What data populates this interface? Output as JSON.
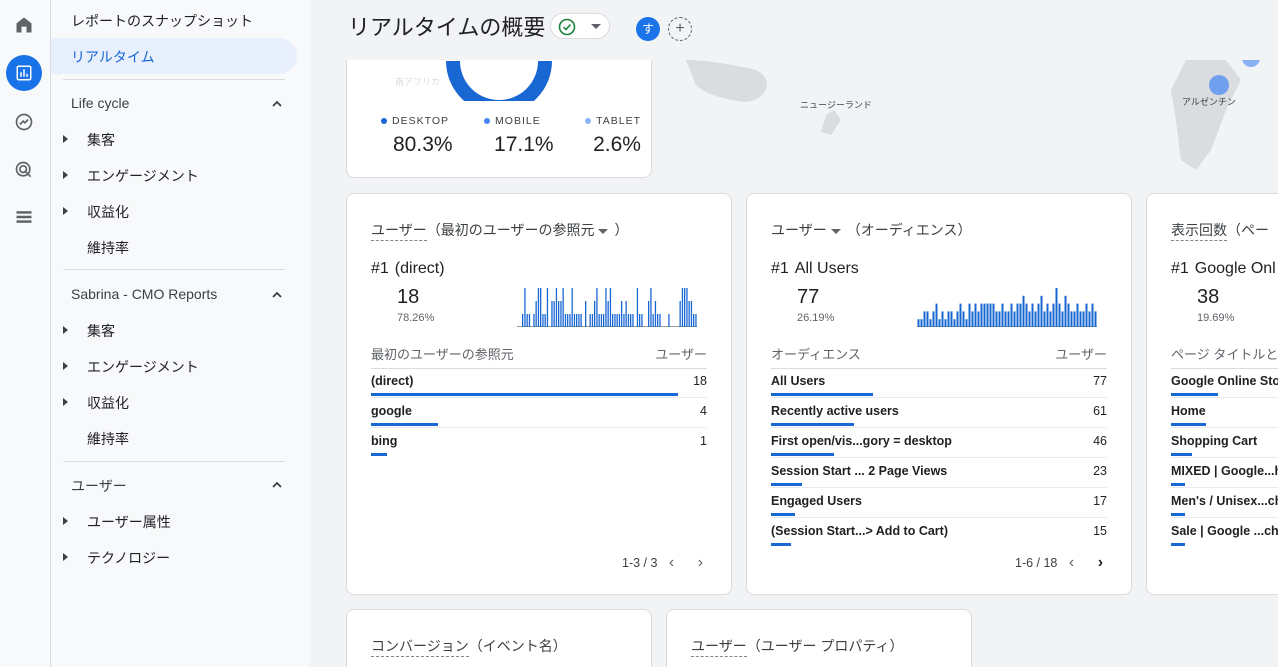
{
  "sidebar": {
    "top_items": [
      "レポートのスナップショット",
      "リアルタイム"
    ],
    "sections": [
      {
        "title": "Life cycle",
        "items": [
          {
            "label": "集客",
            "expandable": true
          },
          {
            "label": "エンゲージメント",
            "expandable": true
          },
          {
            "label": "収益化",
            "expandable": true
          },
          {
            "label": "維持率",
            "expandable": false
          }
        ]
      },
      {
        "title": "Sabrina - CMO Reports",
        "items": [
          {
            "label": "集客",
            "expandable": true
          },
          {
            "label": "エンゲージメント",
            "expandable": true
          },
          {
            "label": "収益化",
            "expandable": true
          },
          {
            "label": "維持率",
            "expandable": false
          }
        ]
      },
      {
        "title": "ユーザー",
        "items": [
          {
            "label": "ユーザー属性",
            "expandable": true
          },
          {
            "label": "テクノロジー",
            "expandable": true
          }
        ]
      }
    ]
  },
  "header": {
    "title": "リアルタイムの概要",
    "avatar_letter": "す",
    "add_symbol": "+"
  },
  "map": {
    "labels": [
      "南アフリカ",
      "ニュージーランド",
      "アルゼンチン"
    ]
  },
  "devices": [
    {
      "label": "DESKTOP",
      "value": "80.3%",
      "color": "#1967d2"
    },
    {
      "label": "MOBILE",
      "value": "17.1%",
      "color": "#4285f4"
    },
    {
      "label": "TABLET",
      "value": "2.6%",
      "color": "#8ab4f8"
    }
  ],
  "cards": [
    {
      "title_main": "ユーザー",
      "title_sub": "（最初のユーザーの参照元",
      "title_end": "）",
      "rank": "#1",
      "top_name": "(direct)",
      "top_value": "18",
      "top_pct": "78.26%",
      "col_left": "最初のユーザーの参照元",
      "col_right": "ユーザー",
      "rows": [
        {
          "name": "(direct)",
          "value": "18",
          "share": 0.78
        },
        {
          "name": "google",
          "value": "4",
          "share": 0.17
        },
        {
          "name": "bing",
          "value": "1",
          "share": 0.04
        }
      ],
      "pager": "1-3 / 3",
      "spark": [
        0,
        0,
        1,
        3,
        1,
        1,
        0,
        1,
        2,
        3,
        3,
        1,
        1,
        3,
        0,
        2,
        2,
        3,
        2,
        2,
        3,
        1,
        1,
        1,
        3,
        1,
        1,
        1,
        1,
        0,
        2,
        0,
        1,
        1,
        2,
        3,
        1,
        1,
        1,
        3,
        2,
        3,
        1,
        1,
        1,
        1,
        2,
        1,
        2,
        1,
        1,
        1,
        0,
        3,
        1,
        1,
        0,
        0,
        2,
        3,
        1,
        2,
        1,
        1,
        0,
        0,
        0,
        1,
        0,
        0,
        0,
        0,
        2,
        3,
        3,
        3,
        2,
        2,
        1,
        1
      ]
    },
    {
      "title_main": "ユーザー",
      "title_sub": "（オーディエンス）",
      "title_end": "",
      "rank": "#1",
      "top_name": "All Users",
      "top_value": "77",
      "top_pct": "26.19%",
      "col_left": "オーディエンス",
      "col_right": "ユーザー",
      "rows": [
        {
          "name": "All Users",
          "value": "77",
          "share": 0.26
        },
        {
          "name": "Recently active users",
          "value": "61",
          "share": 0.21
        },
        {
          "name": "First open/vis...gory = desktop",
          "value": "46",
          "share": 0.16
        },
        {
          "name": "Session Start ... 2 Page Views",
          "value": "23",
          "share": 0.08
        },
        {
          "name": "Engaged Users",
          "value": "17",
          "share": 0.06
        },
        {
          "name": "(Session Start...> Add to Cart)",
          "value": "15",
          "share": 0.05
        }
      ],
      "pager": "1-6 / 18",
      "spark": [
        1,
        1,
        2,
        2,
        1,
        2,
        3,
        1,
        2,
        1,
        2,
        2,
        1,
        2,
        3,
        2,
        1,
        3,
        2,
        3,
        2,
        3,
        3,
        3,
        3,
        3,
        2,
        2,
        3,
        2,
        2,
        3,
        2,
        3,
        3,
        4,
        3,
        2,
        3,
        2,
        3,
        4,
        2,
        3,
        2,
        3,
        5,
        3,
        2,
        4,
        3,
        2,
        2,
        3,
        2,
        2,
        3,
        2,
        3,
        2
      ]
    },
    {
      "title_main": "表示回数",
      "title_sub": "（ペー",
      "title_end": "",
      "rank": "#1",
      "top_name": "Google Onl",
      "top_value": "38",
      "top_pct": "19.69%",
      "col_left": "ページ タイトルと",
      "rows": [
        {
          "name": "Google Online Stor",
          "share": 0.2
        },
        {
          "name": "Home",
          "share": 0.15
        },
        {
          "name": "Shopping Cart",
          "share": 0.09
        },
        {
          "name": "MIXED | Google...h",
          "share": 0.06
        },
        {
          "name": "Men's / Unisex...ch",
          "share": 0.05
        },
        {
          "name": "Sale | Google ...cha",
          "share": 0.04
        }
      ]
    }
  ],
  "bottom_cards": [
    {
      "title_main": "コンバージョン",
      "title_sub": "（イベント名）"
    },
    {
      "title_main": "ユーザー",
      "title_sub": "（ユーザー プロパティ）"
    }
  ]
}
